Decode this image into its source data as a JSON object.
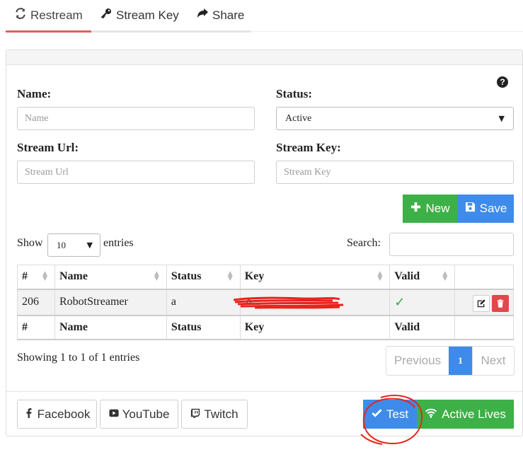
{
  "tabs": [
    {
      "label": "Restream",
      "icon": "sync-icon",
      "active": true
    },
    {
      "label": "Stream Key",
      "icon": "key-icon",
      "active": false
    },
    {
      "label": "Share",
      "icon": "share-icon",
      "active": false
    }
  ],
  "form": {
    "name_label": "Name:",
    "name_placeholder": "Name",
    "status_label": "Status:",
    "status_value": "Active",
    "url_label": "Stream Url:",
    "url_placeholder": "Stream Url",
    "key_label": "Stream Key:",
    "key_placeholder": "Stream Key",
    "help_icon": "question-circle-icon"
  },
  "buttons": {
    "new_label": "New",
    "save_label": "Save"
  },
  "table": {
    "show_label": "Show",
    "length_value": "10",
    "entries_label": "entries",
    "search_label": "Search:",
    "columns": [
      "#",
      "Name",
      "Status",
      "Key",
      "Valid"
    ],
    "rows": [
      {
        "id": "206",
        "name": "RobotStreamer",
        "status": "a",
        "key": "o...",
        "valid": "✓"
      }
    ],
    "info": "Showing 1 to 1 of 1 entries",
    "pager": {
      "previous": "Previous",
      "current": "1",
      "next": "Next"
    }
  },
  "social": {
    "facebook": "Facebook",
    "youtube": "YouTube",
    "twitch": "Twitch"
  },
  "footer": {
    "test_label": "Test",
    "active_lives_label": "Active Lives"
  },
  "colors": {
    "green": "#3db047",
    "blue": "#3e8bea",
    "red": "#e0484b",
    "tab_active": "#e06060"
  }
}
